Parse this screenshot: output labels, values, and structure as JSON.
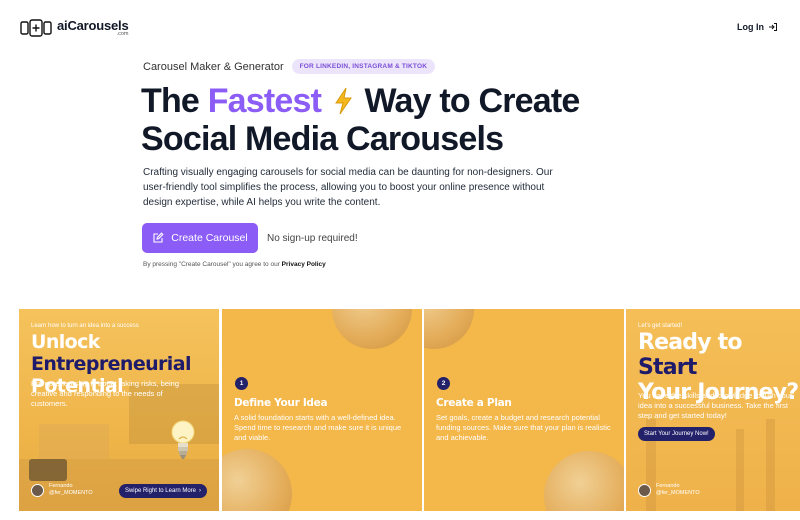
{
  "header": {
    "logo_text": "aiCarousels",
    "logo_domain": ".com",
    "login_label": "Log In"
  },
  "hero": {
    "eyebrow": "Carousel Maker & Generator",
    "pill": "FOR LINKEDIN, INSTAGRAM & TIKTOK",
    "headline_part1": "The ",
    "headline_accent": "Fastest",
    "headline_part2": " Way to Create",
    "headline_line2": "Social Media Carousels",
    "description": "Crafting visually engaging carousels for social media can be daunting for non-designers. Our user-friendly tool simplifies the process, allowing you to boost your online presence without design expertise, while AI helps you write the content.",
    "cta_label": "Create Carousel",
    "no_signup": "No sign-up required!",
    "legal_prefix": "By pressing \"Create Carousel\" you agree to our ",
    "legal_link": "Privacy Policy"
  },
  "slides": {
    "s1": {
      "caption": "Learn how to turn an idea into a success",
      "title_white": "Unlock ",
      "title_dark": "Entrepreneurial",
      "title_white_2": "Potential",
      "body": "Entrepreneurship is about taking risks, being creative and responding to the needs of customers.",
      "author_name": "Fernando",
      "author_handle": "@fer_MOMENTO",
      "swipe_label": "Swipe Right to Learn More"
    },
    "s2": {
      "number": "1",
      "title": "Define Your Idea",
      "body": "A solid foundation starts with a well-defined idea. Spend time to research and make sure it is unique and viable."
    },
    "s3": {
      "number": "2",
      "title": "Create a Plan",
      "body": "Set goals, create a budget and research potential funding sources. Make sure that your plan is realistic and achievable."
    },
    "s4": {
      "caption": "Let's get started!",
      "title_white": "Ready to ",
      "title_dark": "Start",
      "title_white_2": "Your Journey?",
      "body": "You have the skills and knowledge to turn your idea into a successful business. Take the first step and get started today!",
      "button_label": "Start Your Journey Now!",
      "author_name": "Fernando",
      "author_handle": "@fer_MOMENTO"
    }
  },
  "colors": {
    "accent": "#8b5cf6",
    "slide_yellow": "#f3b74a",
    "navy": "#23216a"
  }
}
